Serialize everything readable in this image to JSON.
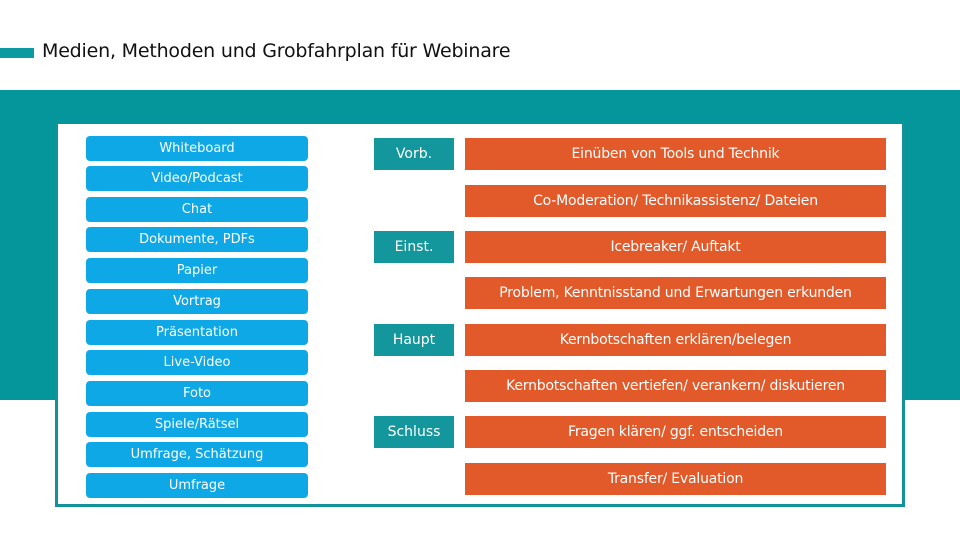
{
  "title": "Medien, Methoden und Grobfahrplan für Webinare",
  "colors": {
    "teal": "#05969b",
    "media_blue": "#0fa8e6",
    "step_orange": "#e2592a",
    "phase_teal": "#13969c"
  },
  "media": [
    "Whiteboard",
    "Video/Podcast",
    "Chat",
    "Dokumente, PDFs",
    "Papier",
    "Vortrag",
    "Präsentation",
    "Live-Video",
    "Foto",
    "Spiele/Rätsel",
    "Umfrage, Schätzung",
    "Umfrage"
  ],
  "phases": [
    "Vorb.",
    "Einst.",
    "Haupt",
    "Schluss"
  ],
  "steps": [
    "Einüben von Tools und Technik",
    "Co-Moderation/ Technikassistenz/ Dateien",
    "Icebreaker/ Auftakt",
    "Problem, Kenntnisstand und Erwartungen erkunden",
    "Kernbotschaften erklären/belegen",
    "Kernbotschaften vertiefen/ verankern/ diskutieren",
    "Fragen klären/ ggf. entscheiden",
    "Transfer/ Evaluation"
  ]
}
